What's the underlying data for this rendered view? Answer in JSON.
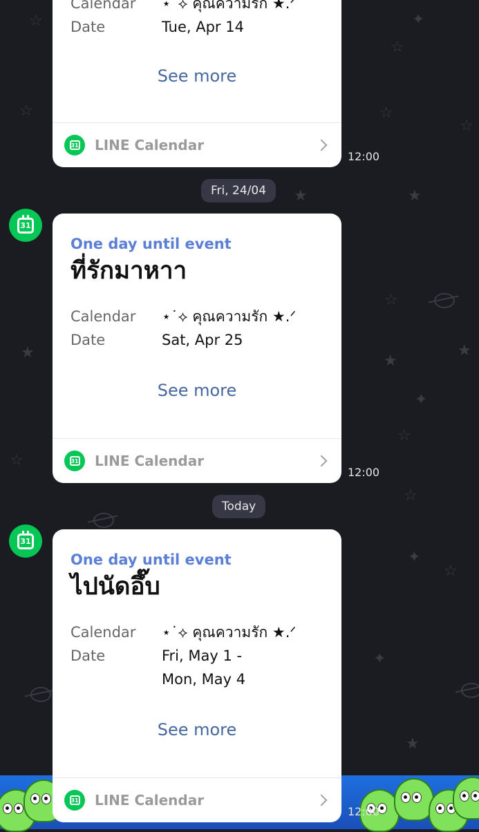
{
  "partial_card": {
    "calendar_label": "Calendar",
    "calendar_value": "⋆˙⟡ คุณความรัก ★.ᐟ",
    "date_label": "Date",
    "date_value": "Tue, Apr 14",
    "see_more": "See more",
    "footer": "LINE Calendar",
    "time": "12:00"
  },
  "separators": {
    "first": "Fri, 24/04",
    "second": "Today"
  },
  "cards": [
    {
      "notice": "One day until event",
      "title": "ที่รักมาหาา",
      "calendar_label": "Calendar",
      "calendar_value": "⋆˙⟡ คุณความรัก ★.ᐟ",
      "date_label": "Date",
      "date_line1": "Sat, Apr 25",
      "date_line2": "",
      "see_more": "See more",
      "footer": "LINE Calendar",
      "time": "12:00"
    },
    {
      "notice": "One day until event",
      "title": "ไปนัดอึ๊บ",
      "calendar_label": "Calendar",
      "calendar_value": "⋆˙⟡ คุณความรัก ★.ᐟ",
      "date_label": "Date",
      "date_line1": "Fri, May 1 -",
      "date_line2": "Mon, May 4",
      "see_more": "See more",
      "footer": "LINE Calendar",
      "time": "12:00"
    }
  ],
  "icons": {
    "calendar_badge_text": "31"
  },
  "colors": {
    "accent_green": "#06c755",
    "notice_blue": "#5b7fd6",
    "link_blue": "#46679e",
    "background": "#1b1c22"
  }
}
